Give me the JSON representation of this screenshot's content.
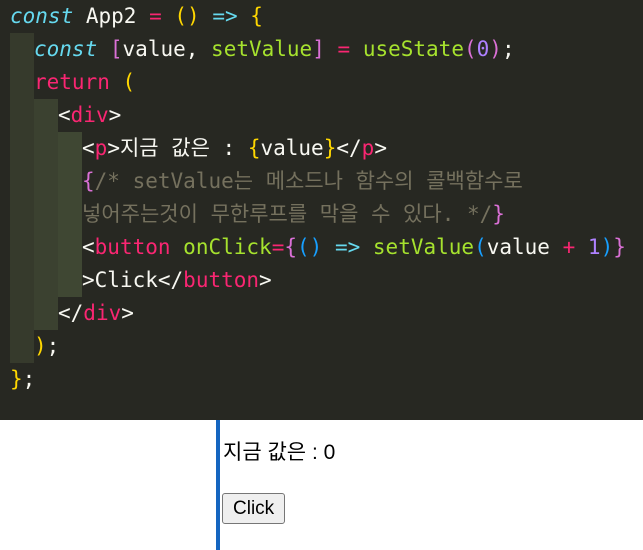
{
  "code": {
    "l1": {
      "kw": "const",
      "name": " App2 ",
      "eq": "=",
      "sp": " ",
      "paren": "()",
      "sp2": " ",
      "arrow": "=>",
      "sp3": " ",
      "brace": "{"
    },
    "l2": {
      "kw": "const",
      "sp": " ",
      "open": "[",
      "v1": "value",
      "comma": ", ",
      "v2": "setValue",
      "close": "]",
      "sp2": " ",
      "eq": "=",
      "sp3": " ",
      "fn": "useState",
      "popen": "(",
      "num": "0",
      "pclose": ")",
      "semi": ";"
    },
    "l3": {
      "kw": "return",
      "sp": " ",
      "paren": "("
    },
    "l4": {
      "lt": "<",
      "tag": "div",
      "gt": ">"
    },
    "l5": {
      "lt": "<",
      "tag": "p",
      "gt": ">",
      "text": "지금 값은 : ",
      "bopen": "{",
      "val": "value",
      "bclose": "}",
      "lt2": "</",
      "tag2": "p",
      "gt2": ">"
    },
    "l6": {
      "bopen": "{",
      "comment": "/* setValue는 메소드나 함수의 콜백함수로"
    },
    "l7": {
      "comment": "넣어주는것이 무한루프를 막을 수 있다. */",
      "bclose": "}"
    },
    "l8": {
      "lt": "<",
      "tag": "button",
      "sp": " ",
      "attr": "onClick",
      "eq": "=",
      "bopen": "{",
      "paren": "()",
      "sp2": " ",
      "arrow": "=>",
      "sp3": " ",
      "fn": "setValue",
      "popen": "(",
      "arg": "value",
      "sp4": " ",
      "plus": "+",
      "sp5": " ",
      "num": "1",
      "pclose": ")",
      "bclose": "}"
    },
    "l9": {
      "gt": ">",
      "text": "Click",
      "lt": "</",
      "tag": "button",
      "gt2": ">"
    },
    "l10": {
      "lt": "</",
      "tag": "div",
      "gt": ">"
    },
    "l11": {
      "paren": ")",
      "semi": ";"
    },
    "l12": {
      "brace": "}",
      "semi": ";"
    }
  },
  "preview": {
    "text": "지금 값은 : 0",
    "button_label": "Click"
  },
  "colors": {
    "editor_bg": "#272822",
    "preview_accent_border": "#1565c0"
  }
}
